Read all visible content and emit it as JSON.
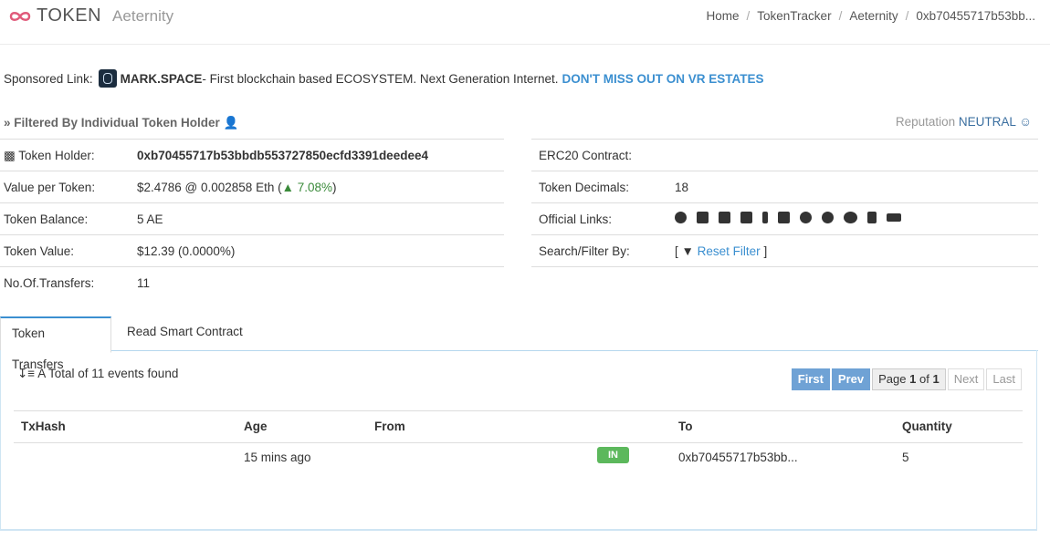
{
  "header": {
    "logo_text": "TOKEN",
    "logo_sub": "Aeternity",
    "breadcrumb": [
      "Home",
      "TokenTracker",
      "Aeternity",
      "0xb70455717b53bb..."
    ]
  },
  "sponsor": {
    "label": "Sponsored Link:",
    "name": "MARK.SPACE",
    "text": " - First blockchain based ECOSYSTEM. Next Generation Internet.",
    "cta": "DON'T MISS OUT ON VR ESTATES"
  },
  "filter": {
    "text": "» Filtered By Individual Token Holder",
    "reputation_label": "Reputation",
    "reputation_value": "NEUTRAL"
  },
  "left_info": [
    {
      "key": "Token Holder:",
      "value": "0xb70455717b53bbdb553727850ecfd3391deedee4"
    },
    {
      "key": "Value per Token:",
      "value": "$2.4786 @ 0.002858 Eth",
      "change": "7.08%"
    },
    {
      "key": "Token Balance:",
      "value": "5 AE"
    },
    {
      "key": "Token Value:",
      "value": "$12.39 (0.0000%)"
    },
    {
      "key": "No.Of.Transfers:",
      "value": "11"
    }
  ],
  "right_info": [
    {
      "key": "ERC20 Contract:",
      "value": ""
    },
    {
      "key": "Token Decimals:",
      "value": "18"
    },
    {
      "key": "Official Links:",
      "value": ""
    },
    {
      "key": "Search/Filter By:",
      "value": "Reset Filter"
    }
  ],
  "official_link_icons": [
    "globe-icon",
    "email-icon",
    "edit-icon",
    "reddit-icon",
    "facebook-icon",
    "twitter-icon",
    "github-icon",
    "telegram-icon",
    "wechat-icon",
    "document-icon",
    "mark-icon"
  ],
  "tabs": [
    "Token Transfers",
    "Read Smart Contract"
  ],
  "transfers": {
    "total_text": "A Total of 11 events found",
    "pager": {
      "first": "First",
      "prev": "Prev",
      "page_word": "Page",
      "page": "1",
      "of": "of",
      "total": "1",
      "next": "Next",
      "last": "Last"
    },
    "columns": [
      "TxHash",
      "Age",
      "From",
      "To",
      "Quantity"
    ],
    "rows": [
      {
        "txhash": "",
        "age": "15 mins ago",
        "from": "",
        "direction": "IN",
        "to": "0xb70455717b53bb...",
        "quantity": "5"
      }
    ]
  },
  "colors": {
    "accent": "#3b8fd0",
    "in_badge": "#5cb85c",
    "logo": "#e05a7a"
  }
}
